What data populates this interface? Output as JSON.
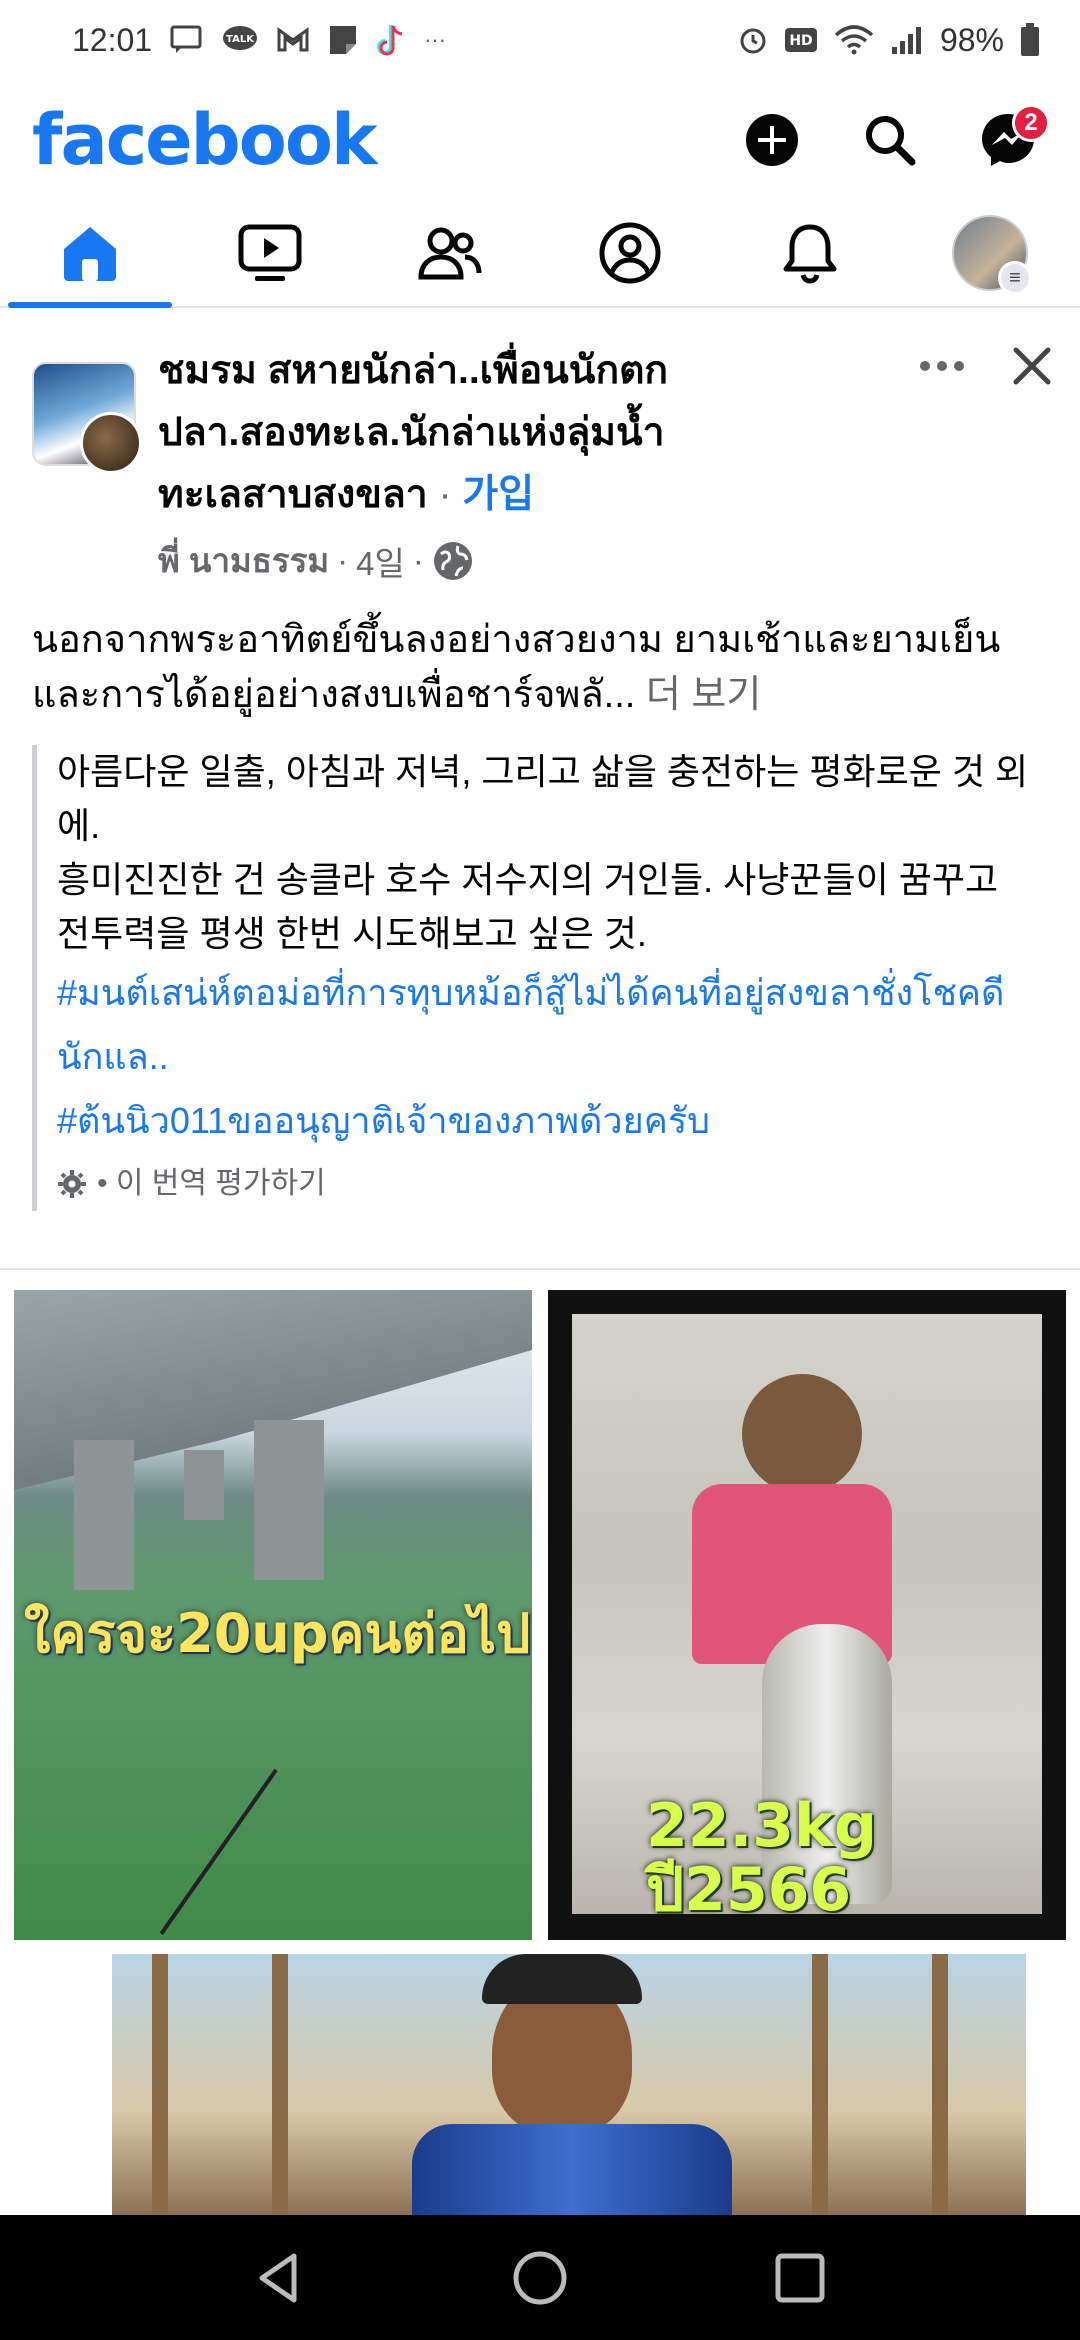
{
  "status_bar": {
    "time": "12:01",
    "battery": "98%",
    "more": "···"
  },
  "header": {
    "logo": "facebook",
    "messenger_badge": "2"
  },
  "post": {
    "group_name": "ชมรม สหายนักล่า..เพื่อนนักตกปลา.สองทะเล.นักล่าแห่งลุ่มน้ำทะเลสาบสงขลา",
    "separator": " · ",
    "join_label": "가입",
    "author": "พี่ นามธรรม",
    "time": "4일",
    "dot": "·",
    "text": "นอกจากพระอาทิตย์ขึ้นลงอย่างสวยงาม ยามเช้าและยามเย็น และการได้อยู่อย่างสงบเพื่อชาร์จพลั...",
    "see_more": "더 보기",
    "translation_lines": [
      "아름다운 일출, 아침과 저녁, 그리고 삶을 충전하는 평화로운 것 외에.",
      "흥미진진한 건 송클라 호수 저수지의 거인들. 사냥꾼들이 꿈꾸고 전투력을 평생 한번 시도해보고 싶은 것."
    ],
    "hashtag_1": "#มนต์เสน่ห์ตอม่อที่การทุบหม้อก็สู้ไม่ได้คนที่อยู่สงขลาชั่งโชคดีนักแล..",
    "hashtag_2": "#ต้นนิว011ขออนุญาติเจ้าของภาพด้วยครับ",
    "rate_translation": "• 이 번역 평가하기"
  },
  "photos": {
    "photo_1_overlay": "ใครจะ20upคนต่อไป?",
    "photo_2_overlay_line1": "22.3kg",
    "photo_2_overlay_line2": "ปี2566"
  }
}
